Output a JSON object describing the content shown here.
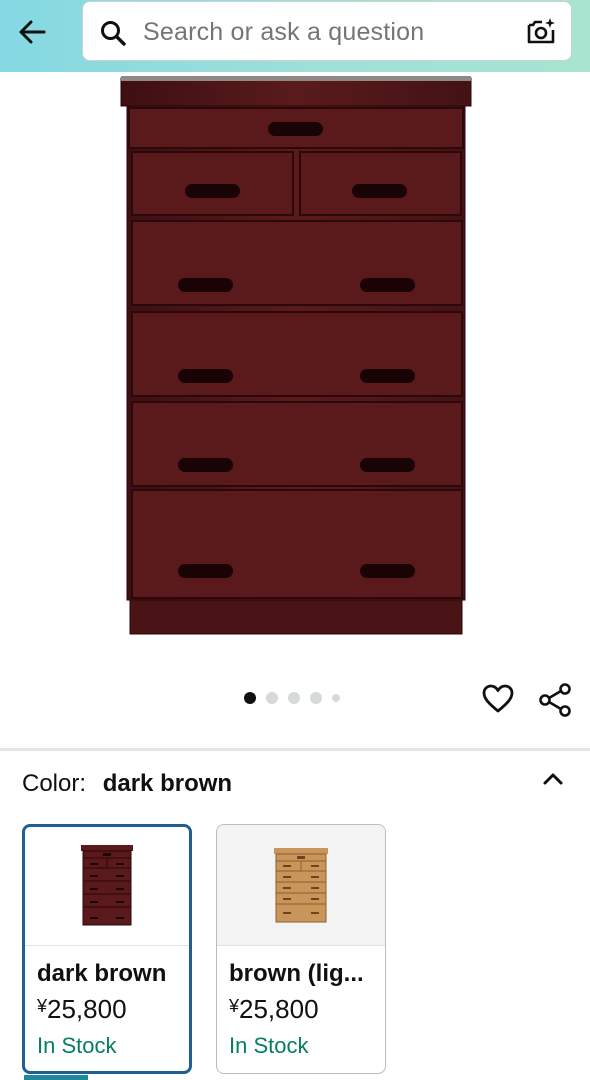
{
  "header": {
    "search_placeholder": "Search or ask a question",
    "back_icon": "arrow-left-icon",
    "search_icon": "magnifier-icon",
    "camera_icon": "camera-sparkle-icon",
    "gradient_colors": [
      "#84d8e2",
      "#a8e4d0"
    ]
  },
  "gallery": {
    "image_count": 5,
    "active_index": 0,
    "favorite_icon": "heart-icon",
    "share_icon": "share-icon"
  },
  "variation": {
    "label": "Color:",
    "selected_value": "dark brown",
    "collapse_icon": "chevron-up-icon",
    "options": [
      {
        "name": "dark brown",
        "currency": "¥",
        "price": "25,800",
        "availability": "In Stock",
        "selected": true,
        "wood_color": "#5a1a1c"
      },
      {
        "name": "brown (lig...",
        "currency": "¥",
        "price": "25,800",
        "availability": "In Stock",
        "selected": false,
        "wood_color": "#c9955a"
      }
    ]
  },
  "colors": {
    "availability_green": "#067d62",
    "selected_border": "#1f5f92"
  }
}
